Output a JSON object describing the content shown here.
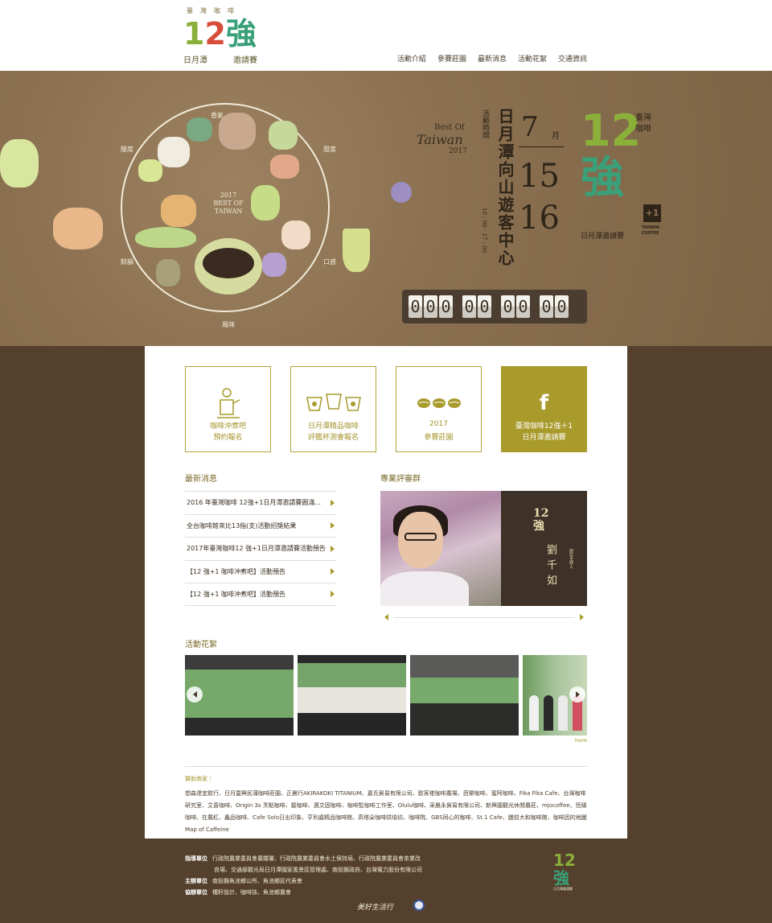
{
  "logo": {
    "small": "臺灣咖啡",
    "num_a": "1",
    "num_b": "2",
    "num_c": "強",
    "sub_left": "日月潭",
    "sub_right": "邀請賽"
  },
  "nav": [
    "活動介紹",
    "參賽莊園",
    "最新消息",
    "活動花絮",
    "交通資訊"
  ],
  "hero": {
    "plate_labels": {
      "top": "香氣",
      "left_upper": "酸度",
      "right_upper": "甜度",
      "left_lower": "餘韻",
      "right_lower": "口感",
      "bottom": "風味"
    },
    "plate_center": [
      "2017",
      "BEST OF",
      "TAIWAN"
    ],
    "bestof": {
      "t1": "Best Of",
      "t2": "Taiwan",
      "t3": "2017"
    },
    "event_label": "活動時間",
    "venue": "日月潭向山遊客中心",
    "times": "10 : 00 - 17 : 00",
    "month": "7",
    "month_label": "月",
    "day1": "15",
    "day2": "16",
    "brand": {
      "n12": "12",
      "qiang": "強",
      "tw": "臺灣咖啡",
      "plus": "+1",
      "tc": "TAIWAN COFFEE",
      "cn": "日月潭邀請賽"
    },
    "counter": [
      [
        "0",
        "0",
        "0"
      ],
      [
        "0",
        "0"
      ],
      [
        "0",
        "0"
      ],
      [
        "0",
        "0"
      ]
    ]
  },
  "cards": [
    {
      "icon": "barista-icon",
      "l1": "咖啡沖煮吧",
      "l2": "預約報名"
    },
    {
      "icon": "cups-icon",
      "l1": "日月潭精品咖啡",
      "l2": "評鑑杯測會報名"
    },
    {
      "icon": "beans-icon",
      "l1": "2017",
      "l2": "參賽莊園"
    },
    {
      "icon": "facebook-icon",
      "l1": "臺灣咖啡12強＋1",
      "l2": "日月潭邀請賽"
    }
  ],
  "news": {
    "title": "最新消息",
    "items": [
      "2016 年臺灣咖啡 12強+1日月潭邀請賽圓滿...",
      "全台咖啡館來比13指(支)活動招獎結果",
      "2017年臺灣咖啡12 強+1日月潭邀請賽活動預告",
      "【12 強+1 咖啡沖煮吧】活動預告",
      "【12 強+1 咖啡沖煮吧】活動預告"
    ]
  },
  "judges": {
    "title": "專業評審群",
    "logo_line1": "12",
    "logo_line2": "強",
    "role": "節目主持人",
    "name": "劉千如"
  },
  "gallery": {
    "title": "活動花絮",
    "more": "more"
  },
  "sponsor": {
    "title": "贊助商家｜",
    "text": "想森達宜飲行、日月靈興民蒲咖啡莊園、正晨行AKIRAKOKI TITANIUM、嘉氏貿易有限公司、歐客佬咖啡農場、芭樂咖啡、蜜阿咖啡、Fika Fika Cafe、台灣咖啡研究室、艾喜咖啡、Origin 3s 烹點咖啡、握咖啡、遇文固咖啡、咖啡監咖啡工作室、Olulu咖啡、采晨永貿易有限公司、新興園觀光休閒農莊、mjocoffee、恆緣咖啡、在農紅、鑫品咖啡、Cafe Solo日出印象、亨利處精品咖啡館、高塔朵咖啡烘焙坊、咖啡院、GBS同心的咖啡、St.1 Cafe、膳前大和咖啡館、咖啡因的地圖 Map of Caffeine"
  },
  "footer": {
    "guide_label": "指導單位",
    "guide_1": "行政院農業委員會農糧署、行政院農業委員會水土保持局、行政院農業委員會茶業改",
    "guide_2": "良場、交通部觀光局日月潭國家風景區管理處、南投縣政府、台灣電力股份有限公司",
    "host_label": "主辦單位",
    "host": "南投縣魚池鄉公所、魚池鄉民代表會",
    "co_label": "協辦單位",
    "co": "種籽設計、咖啡誌、魚池鄉農會",
    "logo_n": "12",
    "logo_q": "強",
    "logo_s": "日月潭邀請賽",
    "signature": "美好生活行"
  }
}
